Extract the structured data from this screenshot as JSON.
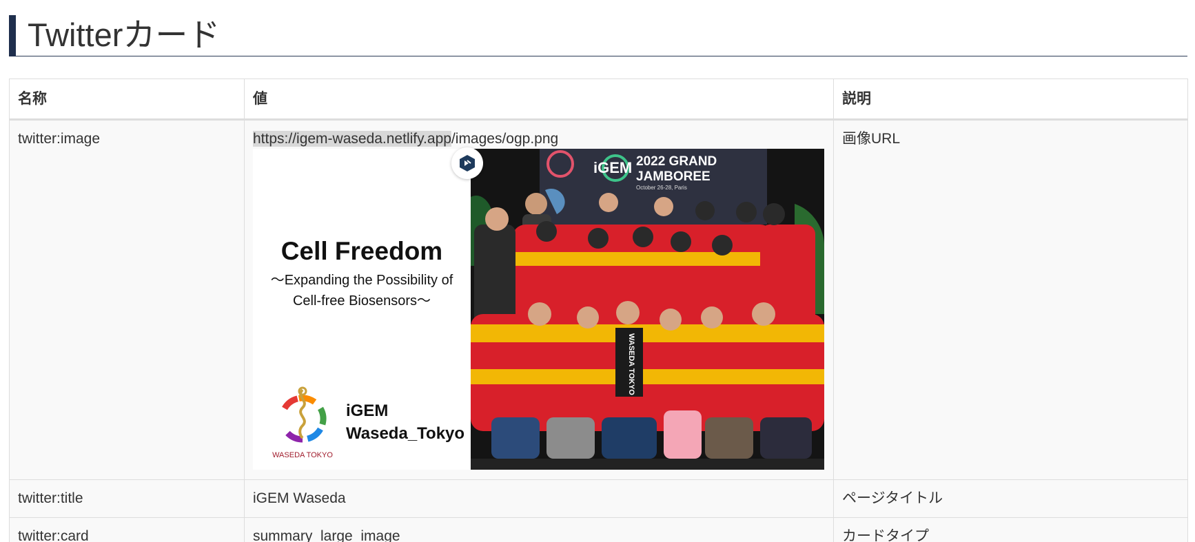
{
  "heading": {
    "title": "Twitterカード"
  },
  "table": {
    "headers": {
      "name": "名称",
      "value": "値",
      "description": "説明"
    },
    "rows": [
      {
        "name": "twitter:image",
        "value_highlight": "https://igem-waseda.netlify.app",
        "value_rest": "/images/ogp.png",
        "description": "画像URL"
      },
      {
        "name": "twitter:title",
        "value": "iGEM Waseda",
        "description": "ページタイトル"
      },
      {
        "name": "twitter:card",
        "value": "summary_large_image",
        "description": "カードタイプ"
      }
    ]
  },
  "og_image": {
    "title": "Cell Freedom",
    "subtitle_line1": "〜Expanding the Possibility of",
    "subtitle_line2": "Cell-free Biosensors〜",
    "team_line1": "iGEM",
    "team_line2": "Waseda_Tokyo",
    "logo_caption": "WASEDA TOKYO",
    "banner_igem": "iGEM",
    "banner_line1": "2022 GRAND",
    "banner_line2": "JAMBOREE",
    "banner_date": "October 26-28, Paris",
    "jacket_text": "WASEDA TOKYO",
    "colors": {
      "jacket_red": "#d8202a",
      "jacket_yellow": "#f2b705",
      "banner_bg": "#2e3140",
      "heading_bar": "#1f2f4d"
    }
  },
  "extension_badge": {
    "icon": "extension-logo-icon"
  }
}
